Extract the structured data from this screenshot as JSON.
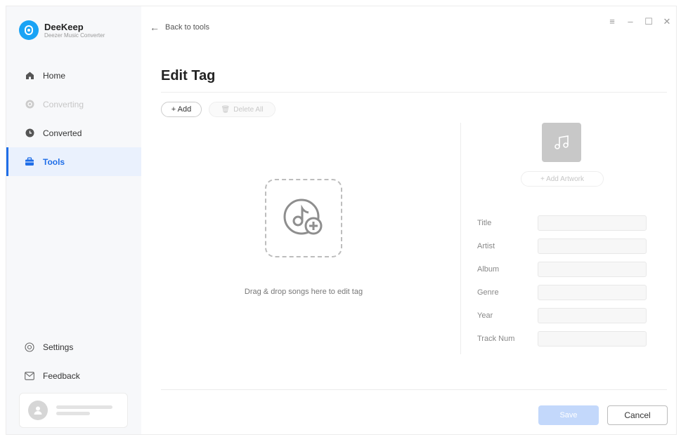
{
  "app": {
    "name": "DeeKeep",
    "subtitle": "Deezer Music Converter"
  },
  "sidebar": {
    "items": [
      {
        "label": "Home",
        "icon": "home-icon",
        "state": "normal"
      },
      {
        "label": "Converting",
        "icon": "converting-icon",
        "state": "disabled"
      },
      {
        "label": "Converted",
        "icon": "clock-icon",
        "state": "normal"
      },
      {
        "label": "Tools",
        "icon": "toolbox-icon",
        "state": "active"
      }
    ],
    "bottom": [
      {
        "label": "Settings",
        "icon": "gear-icon"
      },
      {
        "label": "Feedback",
        "icon": "mail-icon"
      }
    ]
  },
  "header": {
    "back_label": "Back to tools",
    "controls": [
      "menu-icon",
      "minimize-icon",
      "maximize-icon",
      "close-icon"
    ]
  },
  "page": {
    "title": "Edit Tag",
    "add_label": "+ Add",
    "delete_all_label": "Delete All",
    "drop_text": "Drag & drop songs here to edit tag",
    "add_artwork_label": "+ Add Artwork",
    "fields": [
      {
        "label": "Title",
        "value": ""
      },
      {
        "label": "Artist",
        "value": ""
      },
      {
        "label": "Album",
        "value": ""
      },
      {
        "label": "Genre",
        "value": ""
      },
      {
        "label": "Year",
        "value": ""
      },
      {
        "label": "Track Num",
        "value": ""
      }
    ],
    "save_label": "Save",
    "cancel_label": "Cancel"
  },
  "colors": {
    "accent": "#1f6ee8",
    "logo": "#1aa3f5",
    "save_disabled": "#c3d8fb"
  }
}
